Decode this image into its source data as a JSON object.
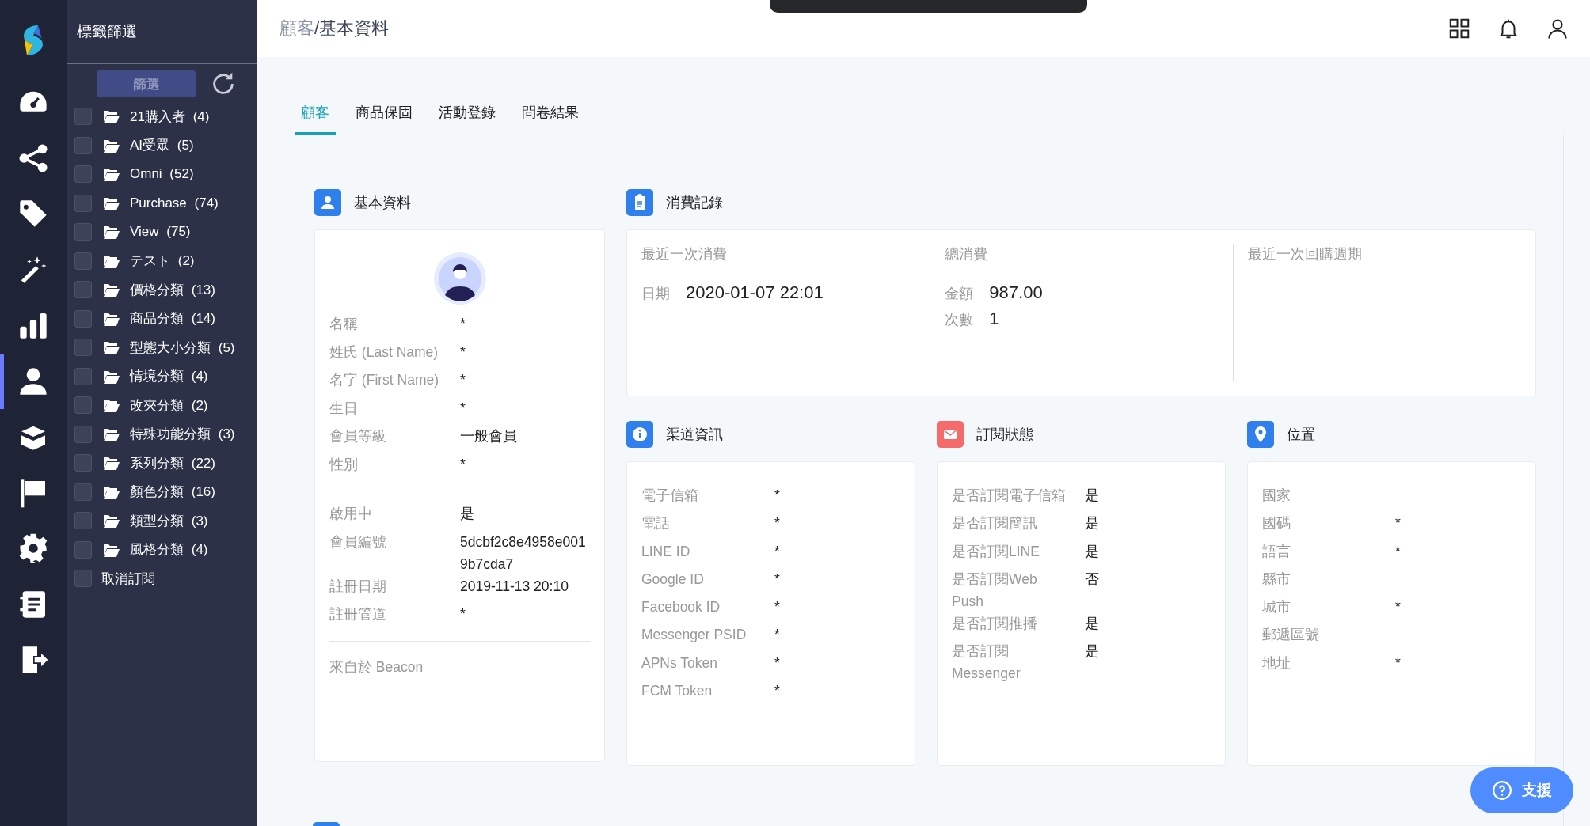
{
  "rail": {
    "items": [
      {
        "selected": false
      },
      {
        "selected": false
      },
      {
        "selected": false
      },
      {
        "selected": false
      },
      {
        "selected": false
      },
      {
        "selected": true
      },
      {
        "selected": false
      },
      {
        "selected": false
      },
      {
        "selected": false
      },
      {
        "selected": false
      },
      {
        "selected": false
      }
    ]
  },
  "tag_panel": {
    "title": "標籤篩選",
    "filter_button": "篩選",
    "tags": [
      {
        "kind": "folder",
        "label": "21購入者 (4)",
        "checked": false
      },
      {
        "kind": "folder",
        "label": "AI受眾 (5)",
        "checked": false
      },
      {
        "kind": "folder",
        "label": "Omni (52)",
        "checked": false
      },
      {
        "kind": "folder",
        "label": "Purchase (74)",
        "checked": false
      },
      {
        "kind": "folder",
        "label": "View (75)",
        "checked": false
      },
      {
        "kind": "folder",
        "label": "テスト (2)",
        "checked": false
      },
      {
        "kind": "folder",
        "label": "價格分類 (13)",
        "checked": false
      },
      {
        "kind": "folder",
        "label": "商品分類 (14)",
        "checked": false
      },
      {
        "kind": "folder",
        "label": "型態大小分類 (5)",
        "checked": false
      },
      {
        "kind": "folder",
        "label": "情境分類 (4)",
        "checked": false
      },
      {
        "kind": "folder",
        "label": "改夾分類 (2)",
        "checked": false
      },
      {
        "kind": "folder",
        "label": "特殊功能分類 (3)",
        "checked": false
      },
      {
        "kind": "folder",
        "label": "系列分類 (22)",
        "checked": false
      },
      {
        "kind": "folder",
        "label": "顏色分類 (16)",
        "checked": false
      },
      {
        "kind": "folder",
        "label": "類型分類 (3)",
        "checked": false
      },
      {
        "kind": "folder",
        "label": "風格分類 (4)",
        "checked": false
      },
      {
        "kind": "plain",
        "label": "取消訂閱",
        "checked": false
      }
    ]
  },
  "breadcrumb": {
    "parent": "顧客",
    "current": "/基本資料"
  },
  "tabs": [
    {
      "label": "顧客",
      "selected": true
    },
    {
      "label": "商品保固",
      "selected": false
    },
    {
      "label": "活動登錄",
      "selected": false
    },
    {
      "label": "問卷結果",
      "selected": false
    }
  ],
  "basic_info": {
    "title": "基本資料",
    "groups": [
      [
        {
          "label": "名稱",
          "value": "*"
        },
        {
          "label": "姓氏 (Last Name)",
          "value": "*"
        },
        {
          "label": "名字 (First Name)",
          "value": "*"
        },
        {
          "label": "生日",
          "value": "*"
        },
        {
          "label": "會員等級",
          "value": "一般會員"
        },
        {
          "label": "性別",
          "value": "*"
        }
      ],
      [
        {
          "label": "啟用中",
          "value": "是"
        },
        {
          "label": "會員編號",
          "value": "5dcbf2c8e4958e0019b7cda7"
        },
        {
          "label": "註冊日期",
          "value": "2019-11-13 20:10"
        },
        {
          "label": "註冊管道",
          "value": "*"
        }
      ]
    ],
    "source": "來自於 Beacon"
  },
  "purchase_record": {
    "title": "消費記錄",
    "columns": [
      {
        "heading": "最近一次消費",
        "fields": [
          {
            "label": "日期",
            "value": "2020-01-07 22:01"
          }
        ]
      },
      {
        "heading": "總消費",
        "fields": [
          {
            "label": "金額",
            "value": "987.00"
          },
          {
            "label": "次數",
            "value": "1"
          }
        ]
      },
      {
        "heading": "最近一次回購週期"
      }
    ]
  },
  "info_cards": [
    {
      "kind": "info",
      "title": "渠道資訊",
      "fields": [
        {
          "label": "電子信箱",
          "value": "*"
        },
        {
          "label": "電話",
          "value": "*"
        },
        {
          "label": "LINE ID",
          "value": "*"
        },
        {
          "label": "Google ID",
          "value": "*"
        },
        {
          "label": "Facebook ID",
          "value": "*"
        },
        {
          "label": "Messenger PSID",
          "value": "*"
        },
        {
          "label": "APNs Token",
          "value": "*"
        },
        {
          "label": "FCM Token",
          "value": "*"
        }
      ]
    },
    {
      "kind": "mail",
      "title": "訂閱狀態",
      "fields": [
        {
          "label": "是否訂閱電子信箱",
          "value": "是"
        },
        {
          "label": "是否訂閱簡訊",
          "value": "是"
        },
        {
          "label": "是否訂閱LINE",
          "value": "是"
        },
        {
          "label": "是否訂閱Web Push",
          "value": "否"
        },
        {
          "label": "是否訂閱推播",
          "value": "是"
        },
        {
          "label": "是否訂閱 Messenger",
          "value": "是"
        }
      ]
    },
    {
      "kind": "location",
      "title": "位置",
      "fields": [
        {
          "label": "國家"
        },
        {
          "label": "國碼",
          "value": "*"
        },
        {
          "label": "語言",
          "value": "*"
        },
        {
          "label": "縣市"
        },
        {
          "label": "城市",
          "value": "*"
        },
        {
          "label": "郵遞區號"
        },
        {
          "label": "地址",
          "value": "*"
        }
      ]
    }
  ],
  "support_button": "支援"
}
